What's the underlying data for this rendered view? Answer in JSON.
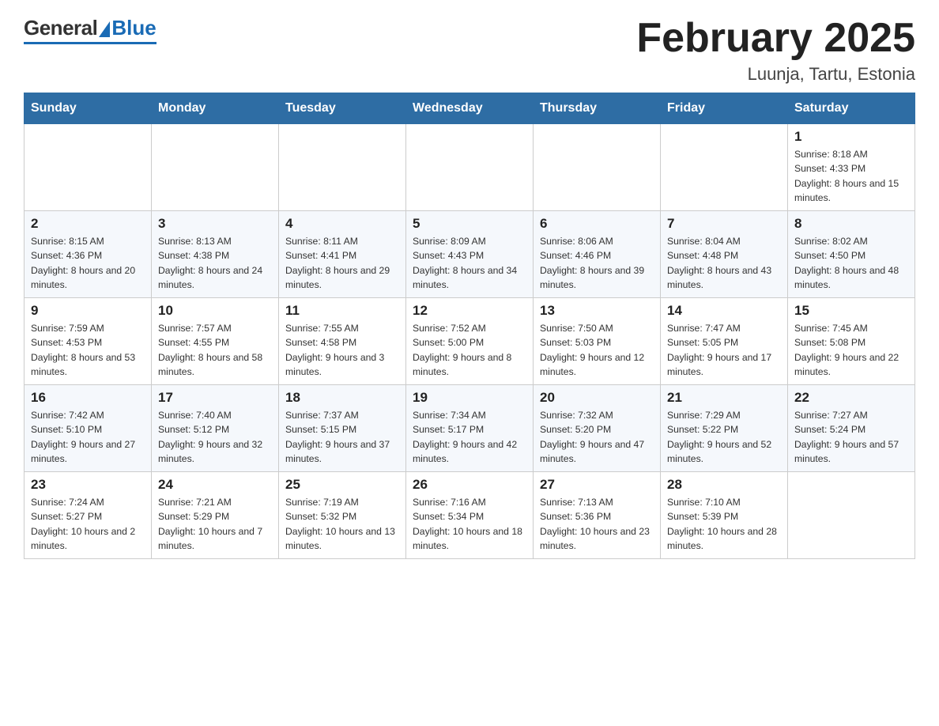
{
  "header": {
    "logo_general": "General",
    "logo_blue": "Blue",
    "month_title": "February 2025",
    "location": "Luunja, Tartu, Estonia"
  },
  "days_of_week": [
    "Sunday",
    "Monday",
    "Tuesday",
    "Wednesday",
    "Thursday",
    "Friday",
    "Saturday"
  ],
  "weeks": [
    [
      {
        "day": "",
        "info": ""
      },
      {
        "day": "",
        "info": ""
      },
      {
        "day": "",
        "info": ""
      },
      {
        "day": "",
        "info": ""
      },
      {
        "day": "",
        "info": ""
      },
      {
        "day": "",
        "info": ""
      },
      {
        "day": "1",
        "info": "Sunrise: 8:18 AM\nSunset: 4:33 PM\nDaylight: 8 hours and 15 minutes."
      }
    ],
    [
      {
        "day": "2",
        "info": "Sunrise: 8:15 AM\nSunset: 4:36 PM\nDaylight: 8 hours and 20 minutes."
      },
      {
        "day": "3",
        "info": "Sunrise: 8:13 AM\nSunset: 4:38 PM\nDaylight: 8 hours and 24 minutes."
      },
      {
        "day": "4",
        "info": "Sunrise: 8:11 AM\nSunset: 4:41 PM\nDaylight: 8 hours and 29 minutes."
      },
      {
        "day": "5",
        "info": "Sunrise: 8:09 AM\nSunset: 4:43 PM\nDaylight: 8 hours and 34 minutes."
      },
      {
        "day": "6",
        "info": "Sunrise: 8:06 AM\nSunset: 4:46 PM\nDaylight: 8 hours and 39 minutes."
      },
      {
        "day": "7",
        "info": "Sunrise: 8:04 AM\nSunset: 4:48 PM\nDaylight: 8 hours and 43 minutes."
      },
      {
        "day": "8",
        "info": "Sunrise: 8:02 AM\nSunset: 4:50 PM\nDaylight: 8 hours and 48 minutes."
      }
    ],
    [
      {
        "day": "9",
        "info": "Sunrise: 7:59 AM\nSunset: 4:53 PM\nDaylight: 8 hours and 53 minutes."
      },
      {
        "day": "10",
        "info": "Sunrise: 7:57 AM\nSunset: 4:55 PM\nDaylight: 8 hours and 58 minutes."
      },
      {
        "day": "11",
        "info": "Sunrise: 7:55 AM\nSunset: 4:58 PM\nDaylight: 9 hours and 3 minutes."
      },
      {
        "day": "12",
        "info": "Sunrise: 7:52 AM\nSunset: 5:00 PM\nDaylight: 9 hours and 8 minutes."
      },
      {
        "day": "13",
        "info": "Sunrise: 7:50 AM\nSunset: 5:03 PM\nDaylight: 9 hours and 12 minutes."
      },
      {
        "day": "14",
        "info": "Sunrise: 7:47 AM\nSunset: 5:05 PM\nDaylight: 9 hours and 17 minutes."
      },
      {
        "day": "15",
        "info": "Sunrise: 7:45 AM\nSunset: 5:08 PM\nDaylight: 9 hours and 22 minutes."
      }
    ],
    [
      {
        "day": "16",
        "info": "Sunrise: 7:42 AM\nSunset: 5:10 PM\nDaylight: 9 hours and 27 minutes."
      },
      {
        "day": "17",
        "info": "Sunrise: 7:40 AM\nSunset: 5:12 PM\nDaylight: 9 hours and 32 minutes."
      },
      {
        "day": "18",
        "info": "Sunrise: 7:37 AM\nSunset: 5:15 PM\nDaylight: 9 hours and 37 minutes."
      },
      {
        "day": "19",
        "info": "Sunrise: 7:34 AM\nSunset: 5:17 PM\nDaylight: 9 hours and 42 minutes."
      },
      {
        "day": "20",
        "info": "Sunrise: 7:32 AM\nSunset: 5:20 PM\nDaylight: 9 hours and 47 minutes."
      },
      {
        "day": "21",
        "info": "Sunrise: 7:29 AM\nSunset: 5:22 PM\nDaylight: 9 hours and 52 minutes."
      },
      {
        "day": "22",
        "info": "Sunrise: 7:27 AM\nSunset: 5:24 PM\nDaylight: 9 hours and 57 minutes."
      }
    ],
    [
      {
        "day": "23",
        "info": "Sunrise: 7:24 AM\nSunset: 5:27 PM\nDaylight: 10 hours and 2 minutes."
      },
      {
        "day": "24",
        "info": "Sunrise: 7:21 AM\nSunset: 5:29 PM\nDaylight: 10 hours and 7 minutes."
      },
      {
        "day": "25",
        "info": "Sunrise: 7:19 AM\nSunset: 5:32 PM\nDaylight: 10 hours and 13 minutes."
      },
      {
        "day": "26",
        "info": "Sunrise: 7:16 AM\nSunset: 5:34 PM\nDaylight: 10 hours and 18 minutes."
      },
      {
        "day": "27",
        "info": "Sunrise: 7:13 AM\nSunset: 5:36 PM\nDaylight: 10 hours and 23 minutes."
      },
      {
        "day": "28",
        "info": "Sunrise: 7:10 AM\nSunset: 5:39 PM\nDaylight: 10 hours and 28 minutes."
      },
      {
        "day": "",
        "info": ""
      }
    ]
  ]
}
